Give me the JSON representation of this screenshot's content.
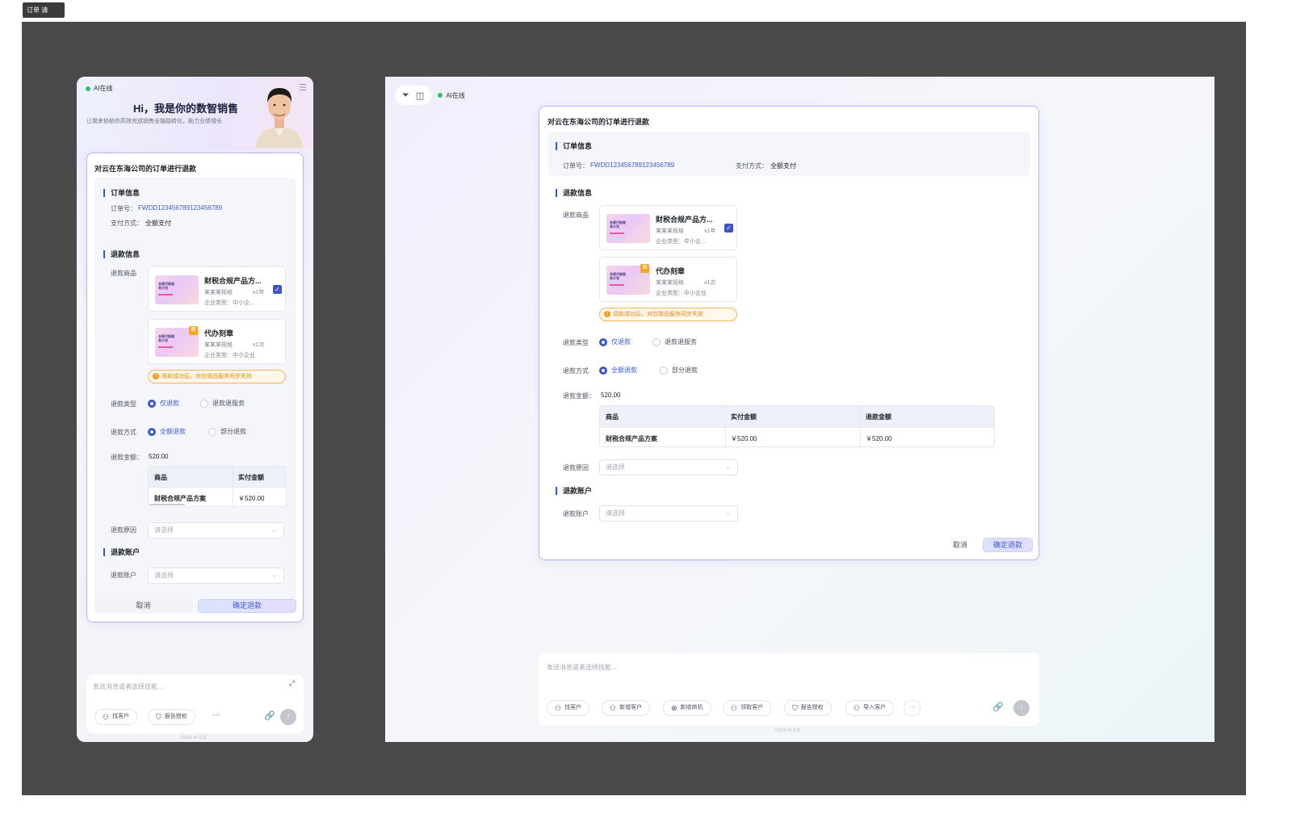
{
  "top_tab": "订单 请",
  "mobile": {
    "online": "AI在线",
    "title": "Hi，我是你的数智销售",
    "subtitle": "让我来协助你高效完成销售全链路转化，助力业绩增长",
    "menu_icon": "menu-icon"
  },
  "desktop": {
    "online": "AI在线",
    "tool_icons": [
      "filter-icon",
      "sidebar-icon"
    ]
  },
  "refund_form": {
    "title": "对云在东海公司的订单进行退款",
    "order_section": "订单信息",
    "order_no_label": "订单号：",
    "order_no": "FWDD12345678912345678​9",
    "pay_method_label": "支付方式：",
    "pay_method": "全额支付",
    "refund_section": "退款信息",
    "goods_label": "退款商品",
    "products": [
      {
        "name": "财税合规产品方...",
        "spec": "某某某规格",
        "qty": "x1年",
        "type": "企业类型：中小企...",
        "thumb": "合规代账服务计划",
        "checked": true
      },
      {
        "name": "代办刻章",
        "spec": "某某某规格",
        "qty": "x1次",
        "type": "企业类型：中小企业",
        "thumb": "合规代账服务计划",
        "gift": "赠"
      }
    ],
    "warning": "退款成功后，对应赠品服务同步失效",
    "refund_type_label": "退款类型",
    "refund_type_options": [
      "仅退款",
      "退款退服务"
    ],
    "refund_method_label": "退款方式",
    "refund_method_options": [
      "全额退款",
      "部分退款"
    ],
    "amount_label": "退款金额：",
    "amount": "520.00",
    "table_headers": [
      "商品",
      "实付金额",
      "退款金额"
    ],
    "table_row": [
      "财税合规产品方案",
      "￥520.00",
      "￥520.00"
    ],
    "reason_label": "退款原因",
    "select_placeholder": "请选择",
    "account_section": "退款账户",
    "account_label": "退款账户",
    "cancel": "取消",
    "confirm": "确定退款"
  },
  "chat": {
    "placeholder": "发送消息或者选择技能...",
    "mobile_chips": [
      "找客户",
      "报告授权"
    ],
    "desktop_chips": [
      "找客户",
      "新增客户",
      "新增商机",
      "领取客户",
      "报告授权",
      "导入客户"
    ],
    "more": "···",
    "footer": "内容由 AI 生成"
  },
  "colors": {
    "accent": "#3d54c7",
    "warning": "#f29b1f",
    "online": "#2ec26b",
    "canvas": "#4a4a4a"
  }
}
